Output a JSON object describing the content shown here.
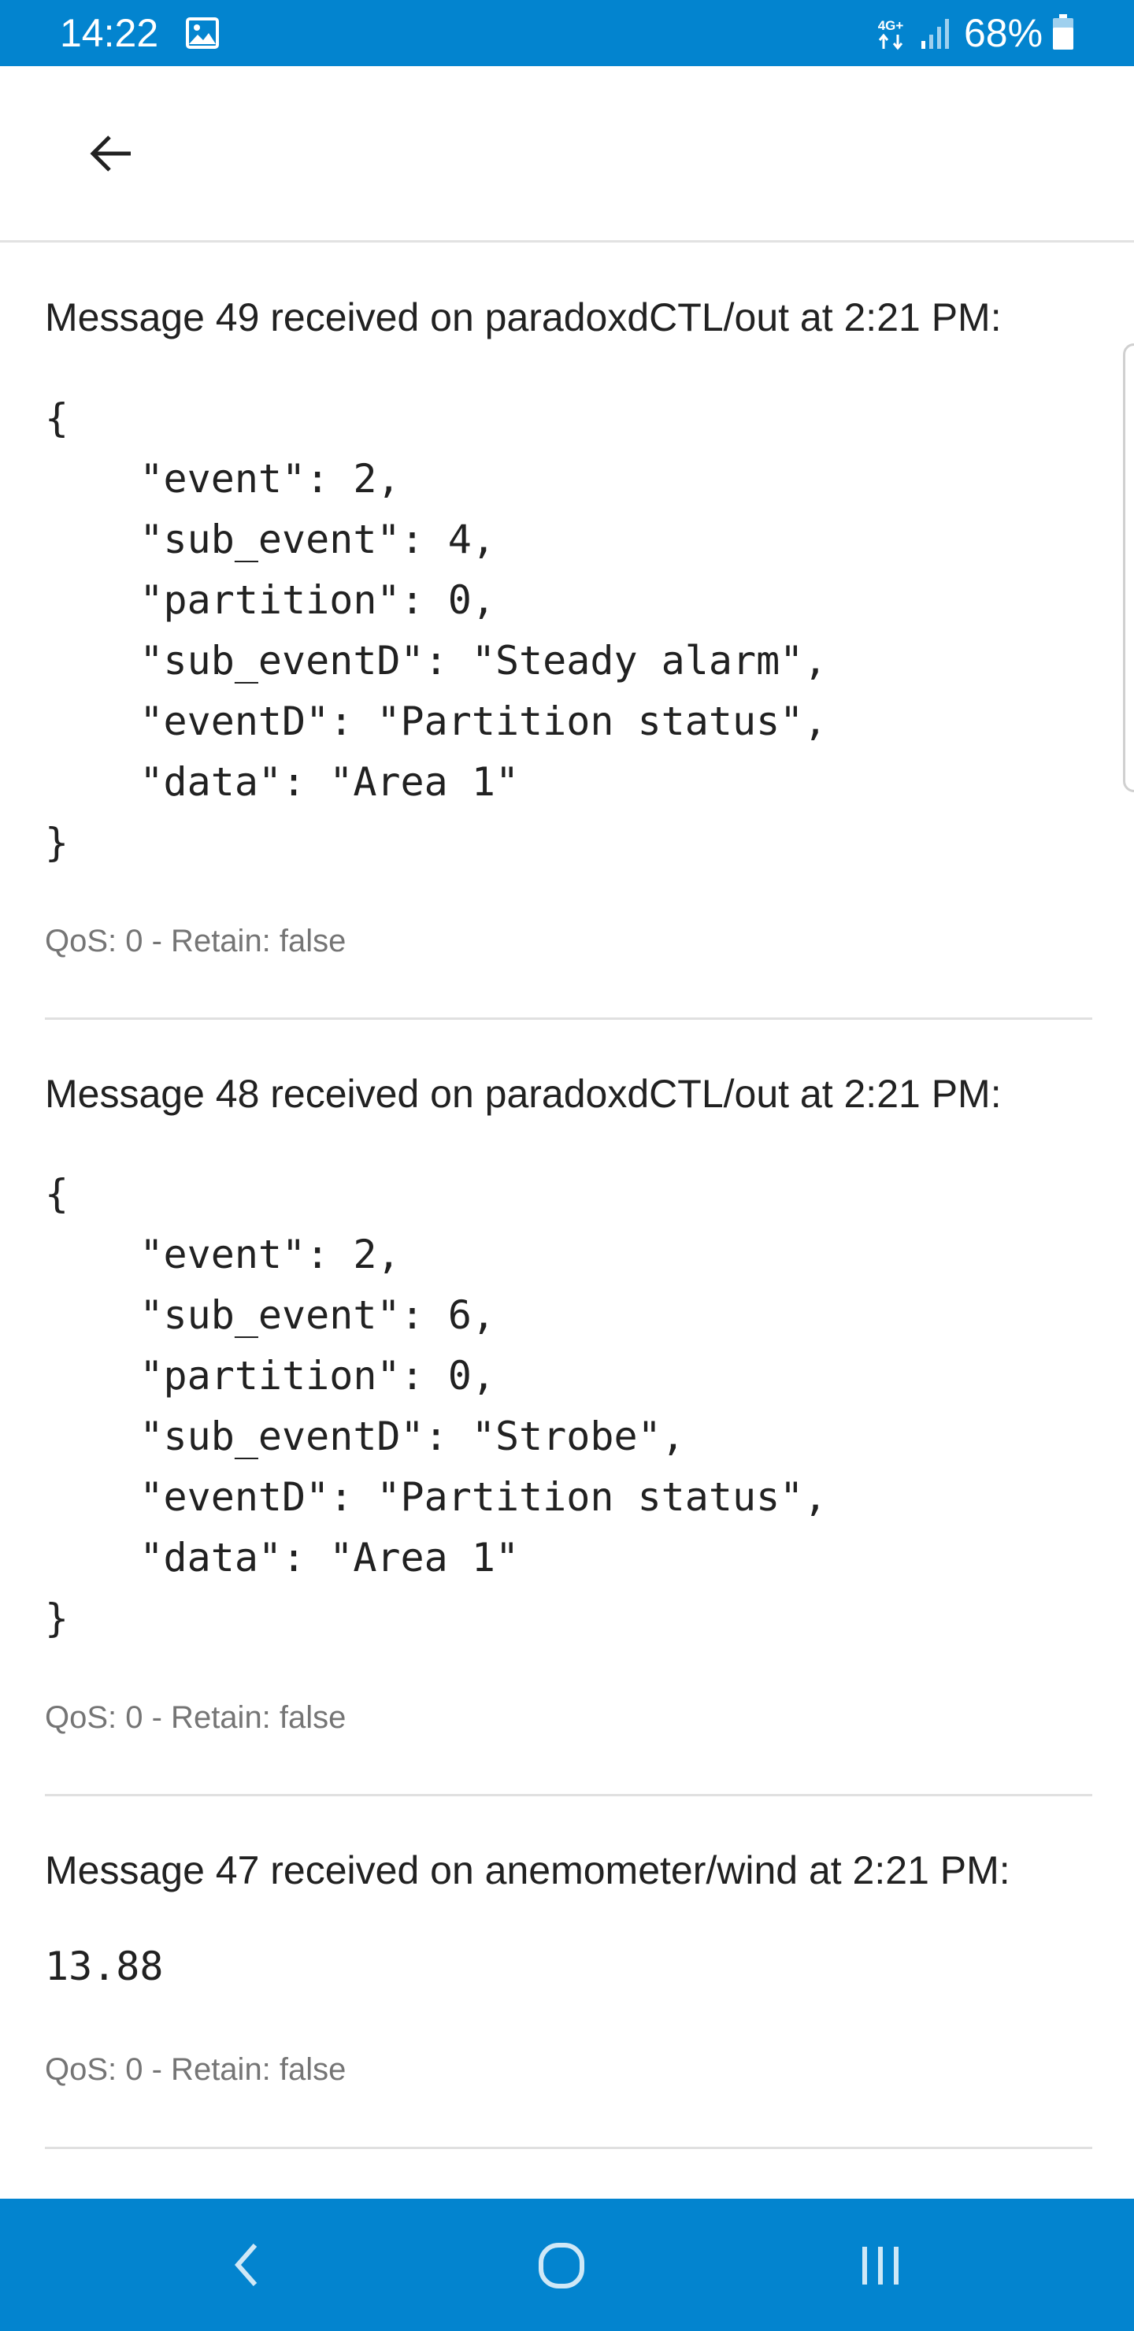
{
  "status_bar": {
    "time": "14:22",
    "network_type": "4G+",
    "battery": "68%",
    "icons": [
      "image-icon",
      "network-icon",
      "signal-icon",
      "battery-icon"
    ]
  },
  "app_bar": {
    "back_icon": "arrow-left-icon"
  },
  "messages": [
    {
      "header": "Message 49 received on paradoxdCTL/out at 2:21 PM:",
      "payload": "{\n    \"event\": 2,\n    \"sub_event\": 4,\n    \"partition\": 0,\n    \"sub_eventD\": \"Steady alarm\",\n    \"eventD\": \"Partition status\",\n    \"data\": \"Area 1\"\n}",
      "qos": "QoS: 0 - Retain: false"
    },
    {
      "header": "Message 48 received on paradoxdCTL/out at 2:21 PM:",
      "payload": "{\n    \"event\": 2,\n    \"sub_event\": 6,\n    \"partition\": 0,\n    \"sub_eventD\": \"Strobe\",\n    \"eventD\": \"Partition status\",\n    \"data\": \"Area 1\"\n}",
      "qos": "QoS: 0 - Retain: false"
    },
    {
      "header": "Message 47 received on anemometer/wind at 2:21 PM:",
      "payload": "13.88",
      "qos": "QoS: 0 - Retain: false"
    }
  ],
  "nav_bar": {
    "icons": [
      "nav-back-icon",
      "nav-home-icon",
      "nav-recents-icon"
    ]
  },
  "colors": {
    "primary": "#0384cf",
    "text": "#212121",
    "secondary_text": "#757575",
    "divider": "#e0e0e0"
  }
}
